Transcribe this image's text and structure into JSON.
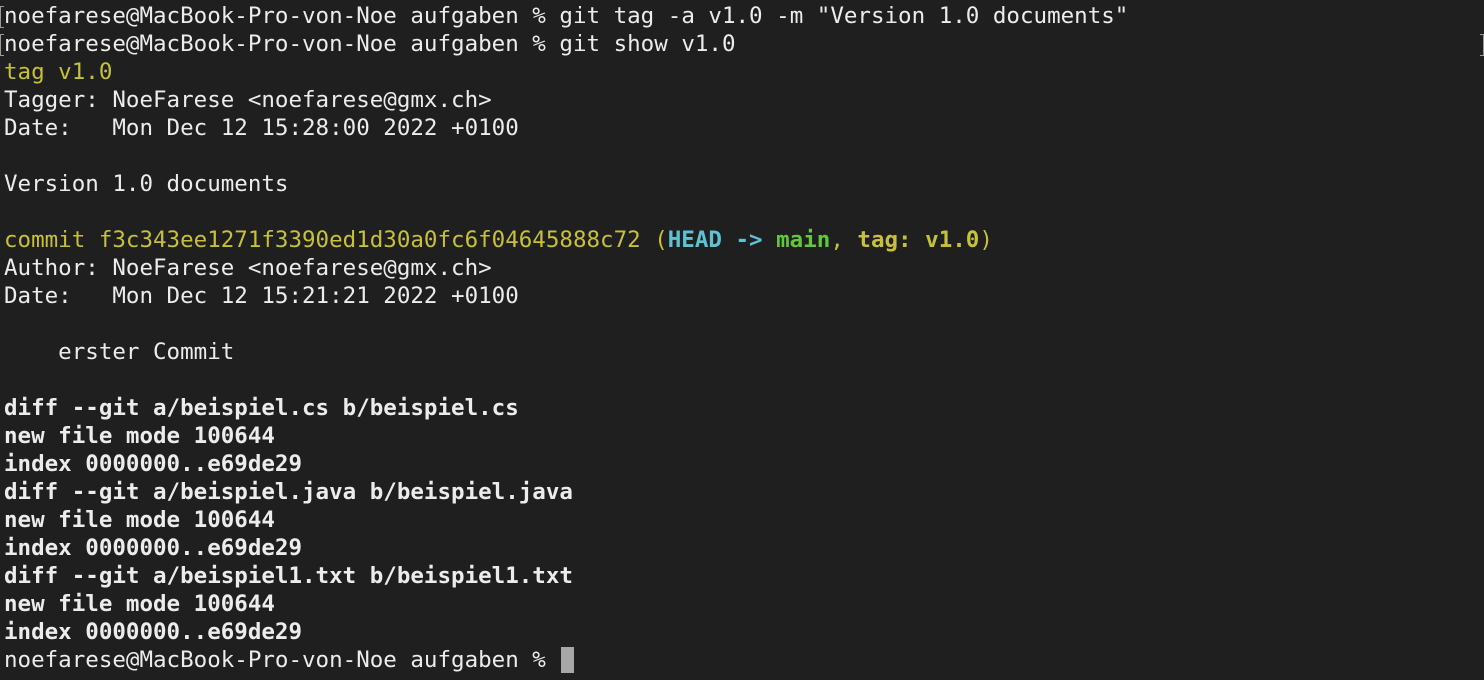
{
  "terminal": {
    "lines": [
      {
        "kind": "command",
        "prompt": "noefarese@MacBook-Pro-von-Noe aufgaben % ",
        "command": "git tag -a v1.0 -m \"Version 1.0 documents\""
      },
      {
        "kind": "command",
        "prompt": "noefarese@MacBook-Pro-von-Noe aufgaben % ",
        "command": "git show v1.0"
      },
      {
        "kind": "tag",
        "text": "tag v1.0"
      },
      {
        "kind": "plain",
        "text": "Tagger: NoeFarese <noefarese@gmx.ch>"
      },
      {
        "kind": "plain",
        "text": "Date:   Mon Dec 12 15:28:00 2022 +0100"
      },
      {
        "kind": "plain",
        "text": ""
      },
      {
        "kind": "plain",
        "text": "Version 1.0 documents"
      },
      {
        "kind": "plain",
        "text": ""
      },
      {
        "kind": "commit",
        "prefix": "commit f3c343ee1271f3390ed1d30a0fc6f04645888c72 (",
        "head": "HEAD -> ",
        "branch": "main",
        "sep": ", ",
        "tag": "tag: v1.0",
        "suffix": ")"
      },
      {
        "kind": "plain",
        "text": "Author: NoeFarese <noefarese@gmx.ch>"
      },
      {
        "kind": "plain",
        "text": "Date:   Mon Dec 12 15:21:21 2022 +0100"
      },
      {
        "kind": "plain",
        "text": ""
      },
      {
        "kind": "plain",
        "text": "    erster Commit"
      },
      {
        "kind": "plain",
        "text": ""
      },
      {
        "kind": "bold",
        "text": "diff --git a/beispiel.cs b/beispiel.cs"
      },
      {
        "kind": "bold",
        "text": "new file mode 100644"
      },
      {
        "kind": "bold",
        "text": "index 0000000..e69de29"
      },
      {
        "kind": "bold",
        "text": "diff --git a/beispiel.java b/beispiel.java"
      },
      {
        "kind": "bold",
        "text": "new file mode 100644"
      },
      {
        "kind": "bold",
        "text": "index 0000000..e69de29"
      },
      {
        "kind": "bold",
        "text": "diff --git a/beispiel1.txt b/beispiel1.txt"
      },
      {
        "kind": "bold",
        "text": "new file mode 100644"
      },
      {
        "kind": "bold",
        "text": "index 0000000..e69de29"
      },
      {
        "kind": "prompt",
        "prompt": "noefarese@MacBook-Pro-von-Noe aufgaben % "
      }
    ]
  },
  "colors": {
    "background": "#1f1f1f",
    "foreground": "#ececec",
    "yellow": "#c7c03a",
    "cyan": "#5fc1d6",
    "green": "#62c73a",
    "cursor": "#a7a7a7"
  }
}
